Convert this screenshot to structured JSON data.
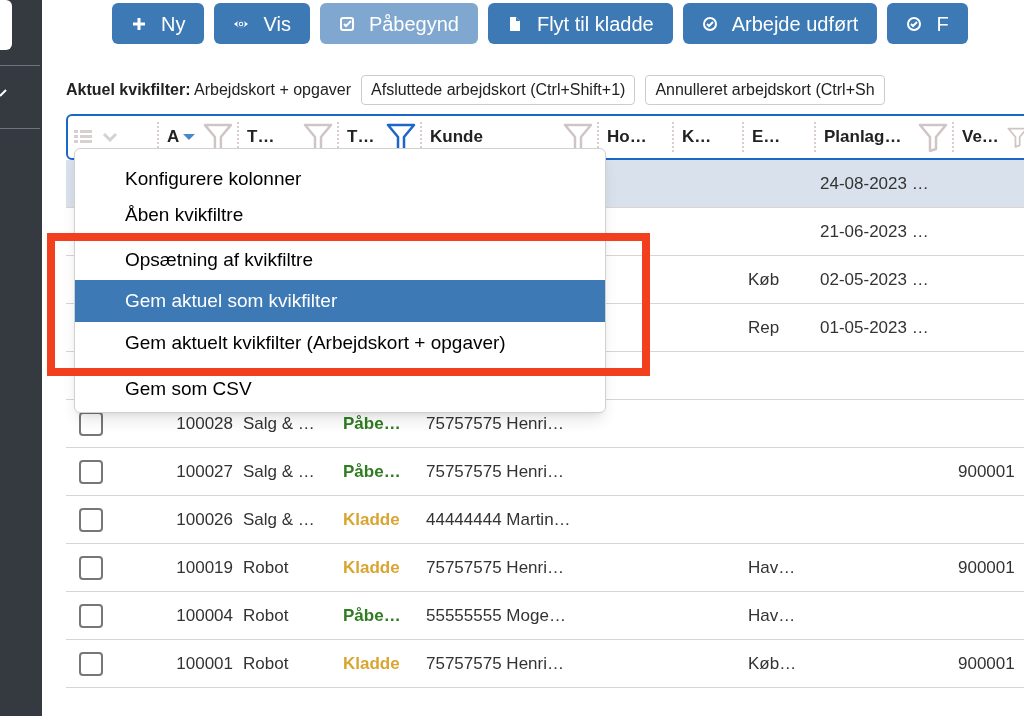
{
  "toolbar": [
    {
      "label": "Ny",
      "disabled": false
    },
    {
      "label": "Vis",
      "disabled": false
    },
    {
      "label": "Påbegynd",
      "disabled": true
    },
    {
      "label": "Flyt til kladde",
      "disabled": false
    },
    {
      "label": "Arbejde udført",
      "disabled": false
    },
    {
      "label": "F",
      "disabled": false
    }
  ],
  "quick_filter": {
    "label": "Aktuel kvikfilter:",
    "value": "Arbejdskort + opgaver",
    "buttons": [
      "Afsluttede arbejdskort (Ctrl+Shift+1)",
      "Annulleret arbejdskort (Ctrl+Sh"
    ]
  },
  "table": {
    "columns": [
      {
        "label": "A",
        "sorted": true,
        "filtered": false
      },
      {
        "label": "T…",
        "sorted": false,
        "filtered": false
      },
      {
        "label": "T…",
        "sorted": false,
        "filtered": true
      },
      {
        "label": "Kunde",
        "sorted": false,
        "filtered": false
      },
      {
        "label": "Ho…",
        "sorted": false
      },
      {
        "label": "K…",
        "sorted": false
      },
      {
        "label": "E…",
        "sorted": false
      },
      {
        "label": "Planlag…",
        "sorted": false,
        "filtered": false
      },
      {
        "label": "Ve…",
        "sorted": false,
        "filtered": false
      }
    ],
    "rows": [
      {
        "selected": true,
        "cells": {
          "planned": "24-08-2023 …"
        }
      },
      {
        "selected": false,
        "cells": {
          "planned": "21-06-2023 …"
        }
      },
      {
        "selected": false,
        "cells": {
          "e": "Køb",
          "planned": "02-05-2023 …"
        }
      },
      {
        "selected": false,
        "cells": {
          "e": "Rep",
          "planned": "01-05-2023 …"
        }
      },
      {
        "selected": false,
        "cells": {}
      },
      {
        "selected": false,
        "checked": false,
        "kind": "started",
        "cells": {
          "id": "100028",
          "type": "Salg & …",
          "status": "Påbe…",
          "customer": "75757575 Henri…"
        }
      },
      {
        "selected": false,
        "checked": false,
        "kind": "started",
        "cells": {
          "id": "100027",
          "type": "Salg & …",
          "status": "Påbe…",
          "customer": "75757575 Henri…",
          "ve": "900001"
        }
      },
      {
        "selected": false,
        "checked": false,
        "kind": "draft",
        "cells": {
          "id": "100026",
          "type": "Salg & …",
          "status": "Kladde",
          "customer": "44444444 Martin…"
        }
      },
      {
        "selected": false,
        "checked": false,
        "kind": "draft",
        "cells": {
          "id": "100019",
          "type": "Robot",
          "status": "Kladde",
          "customer": "75757575 Henri…",
          "e": "Hav…",
          "ve": "900001"
        }
      },
      {
        "selected": false,
        "checked": false,
        "kind": "started",
        "cells": {
          "id": "100004",
          "type": "Robot",
          "status": "Påbe…",
          "customer": "55555555 Moge…",
          "e": "Hav…"
        }
      },
      {
        "selected": false,
        "checked": false,
        "kind": "draft",
        "cells": {
          "id": "100001",
          "type": "Robot",
          "status": "Kladde",
          "customer": "75757575 Henri…",
          "e": "Køb…",
          "ve": "900001"
        }
      }
    ]
  },
  "context_menu": [
    {
      "label": "Konfigurere kolonner",
      "selected": false
    },
    {
      "label": "Åben kvikfiltre",
      "selected": false
    },
    {
      "label": "Opsætning af kvikfiltre",
      "selected": false
    },
    {
      "label": "Gem aktuel som kvikfilter",
      "selected": true
    },
    {
      "label": "Gem aktuelt kvikfilter (Arbejdskort + opgaver)",
      "selected": false
    },
    {
      "label": "Gem som CSV",
      "selected": false
    }
  ]
}
